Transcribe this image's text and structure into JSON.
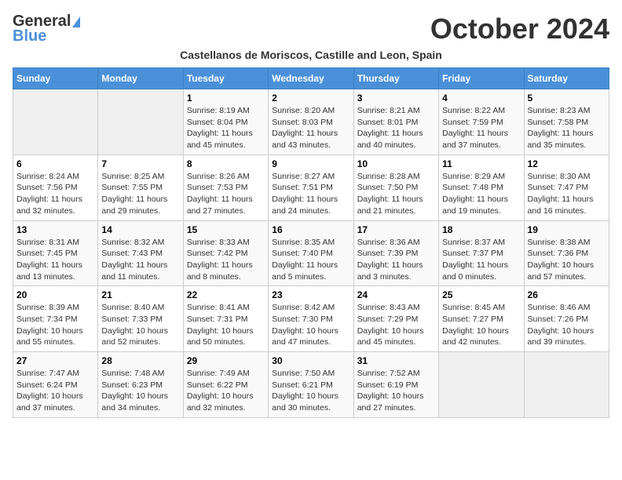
{
  "header": {
    "logo_general": "General",
    "logo_blue": "Blue",
    "title": "October 2024",
    "subtitle": "Castellanos de Moriscos, Castille and Leon, Spain"
  },
  "weekdays": [
    "Sunday",
    "Monday",
    "Tuesday",
    "Wednesday",
    "Thursday",
    "Friday",
    "Saturday"
  ],
  "weeks": [
    [
      {
        "day": "",
        "info": ""
      },
      {
        "day": "",
        "info": ""
      },
      {
        "day": "1",
        "info": "Sunrise: 8:19 AM\nSunset: 8:04 PM\nDaylight: 11 hours and 45 minutes."
      },
      {
        "day": "2",
        "info": "Sunrise: 8:20 AM\nSunset: 8:03 PM\nDaylight: 11 hours and 43 minutes."
      },
      {
        "day": "3",
        "info": "Sunrise: 8:21 AM\nSunset: 8:01 PM\nDaylight: 11 hours and 40 minutes."
      },
      {
        "day": "4",
        "info": "Sunrise: 8:22 AM\nSunset: 7:59 PM\nDaylight: 11 hours and 37 minutes."
      },
      {
        "day": "5",
        "info": "Sunrise: 8:23 AM\nSunset: 7:58 PM\nDaylight: 11 hours and 35 minutes."
      }
    ],
    [
      {
        "day": "6",
        "info": "Sunrise: 8:24 AM\nSunset: 7:56 PM\nDaylight: 11 hours and 32 minutes."
      },
      {
        "day": "7",
        "info": "Sunrise: 8:25 AM\nSunset: 7:55 PM\nDaylight: 11 hours and 29 minutes."
      },
      {
        "day": "8",
        "info": "Sunrise: 8:26 AM\nSunset: 7:53 PM\nDaylight: 11 hours and 27 minutes."
      },
      {
        "day": "9",
        "info": "Sunrise: 8:27 AM\nSunset: 7:51 PM\nDaylight: 11 hours and 24 minutes."
      },
      {
        "day": "10",
        "info": "Sunrise: 8:28 AM\nSunset: 7:50 PM\nDaylight: 11 hours and 21 minutes."
      },
      {
        "day": "11",
        "info": "Sunrise: 8:29 AM\nSunset: 7:48 PM\nDaylight: 11 hours and 19 minutes."
      },
      {
        "day": "12",
        "info": "Sunrise: 8:30 AM\nSunset: 7:47 PM\nDaylight: 11 hours and 16 minutes."
      }
    ],
    [
      {
        "day": "13",
        "info": "Sunrise: 8:31 AM\nSunset: 7:45 PM\nDaylight: 11 hours and 13 minutes."
      },
      {
        "day": "14",
        "info": "Sunrise: 8:32 AM\nSunset: 7:43 PM\nDaylight: 11 hours and 11 minutes."
      },
      {
        "day": "15",
        "info": "Sunrise: 8:33 AM\nSunset: 7:42 PM\nDaylight: 11 hours and 8 minutes."
      },
      {
        "day": "16",
        "info": "Sunrise: 8:35 AM\nSunset: 7:40 PM\nDaylight: 11 hours and 5 minutes."
      },
      {
        "day": "17",
        "info": "Sunrise: 8:36 AM\nSunset: 7:39 PM\nDaylight: 11 hours and 3 minutes."
      },
      {
        "day": "18",
        "info": "Sunrise: 8:37 AM\nSunset: 7:37 PM\nDaylight: 11 hours and 0 minutes."
      },
      {
        "day": "19",
        "info": "Sunrise: 8:38 AM\nSunset: 7:36 PM\nDaylight: 10 hours and 57 minutes."
      }
    ],
    [
      {
        "day": "20",
        "info": "Sunrise: 8:39 AM\nSunset: 7:34 PM\nDaylight: 10 hours and 55 minutes."
      },
      {
        "day": "21",
        "info": "Sunrise: 8:40 AM\nSunset: 7:33 PM\nDaylight: 10 hours and 52 minutes."
      },
      {
        "day": "22",
        "info": "Sunrise: 8:41 AM\nSunset: 7:31 PM\nDaylight: 10 hours and 50 minutes."
      },
      {
        "day": "23",
        "info": "Sunrise: 8:42 AM\nSunset: 7:30 PM\nDaylight: 10 hours and 47 minutes."
      },
      {
        "day": "24",
        "info": "Sunrise: 8:43 AM\nSunset: 7:29 PM\nDaylight: 10 hours and 45 minutes."
      },
      {
        "day": "25",
        "info": "Sunrise: 8:45 AM\nSunset: 7:27 PM\nDaylight: 10 hours and 42 minutes."
      },
      {
        "day": "26",
        "info": "Sunrise: 8:46 AM\nSunset: 7:26 PM\nDaylight: 10 hours and 39 minutes."
      }
    ],
    [
      {
        "day": "27",
        "info": "Sunrise: 7:47 AM\nSunset: 6:24 PM\nDaylight: 10 hours and 37 minutes."
      },
      {
        "day": "28",
        "info": "Sunrise: 7:48 AM\nSunset: 6:23 PM\nDaylight: 10 hours and 34 minutes."
      },
      {
        "day": "29",
        "info": "Sunrise: 7:49 AM\nSunset: 6:22 PM\nDaylight: 10 hours and 32 minutes."
      },
      {
        "day": "30",
        "info": "Sunrise: 7:50 AM\nSunset: 6:21 PM\nDaylight: 10 hours and 30 minutes."
      },
      {
        "day": "31",
        "info": "Sunrise: 7:52 AM\nSunset: 6:19 PM\nDaylight: 10 hours and 27 minutes."
      },
      {
        "day": "",
        "info": ""
      },
      {
        "day": "",
        "info": ""
      }
    ]
  ]
}
